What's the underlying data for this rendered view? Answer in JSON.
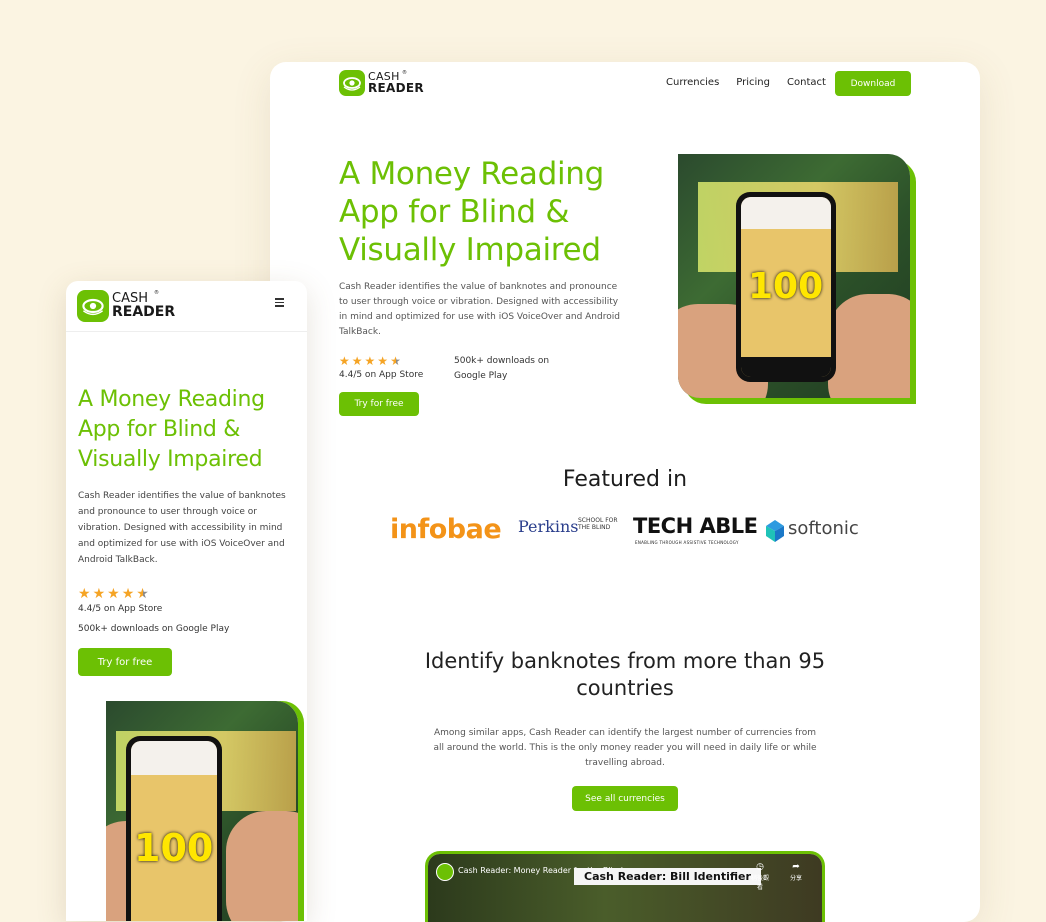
{
  "brand": {
    "line1": "CASH",
    "line2": "READER",
    "reg": "®"
  },
  "colors": {
    "accent": "#6cc004",
    "background": "#fbf4e2",
    "star": "#f5a425"
  },
  "desktop": {
    "nav": {
      "links": [
        "Currencies",
        "Pricing",
        "Contact"
      ],
      "download_label": "Download"
    },
    "hero": {
      "title": "A Money Reading App for Blind & Visually Impaired",
      "description": "Cash Reader identifies the value of banknotes and pronounce to user through voice or vibration. Designed with accessibility in mind and optimized for use with iOS VoiceOver and Android TalkBack.",
      "rating_value": 4.4,
      "rating_text": "4.4/5 on App Store",
      "downloads_text": "500k+ downloads on Google Play",
      "cta_label": "Try for free",
      "image_value": "100"
    },
    "featured": {
      "heading": "Featured in",
      "logos": {
        "infobae": "infobae",
        "perkins": "Perkins",
        "perkins_sub": "SCHOOL FOR THE BLIND",
        "techable": "TECH ABLE",
        "techable_sub": "ENABLING THROUGH ASSISTIVE TECHNOLOGY",
        "softonic": "softonic"
      }
    },
    "identify": {
      "heading": "Identify banknotes from more than 95 countries",
      "description": "Among similar apps, Cash Reader can identify the largest number of currencies from all around the world. This is the only money reader you will need in daily life or while travelling abroad.",
      "cta_label": "See all currencies"
    },
    "video": {
      "title": "Cash Reader: Money Reader for the Blind",
      "thumb_text": "Cash Reader: Bill Identifier",
      "watch_later_label": "稍後觀看",
      "share_label": "分享"
    }
  },
  "mobile": {
    "hero": {
      "title": "A Money Reading App for Blind & Visually Impaired",
      "description": "Cash Reader identifies the value of banknotes and pronounce to user through voice or vibration. Designed with accessibility in mind and optimized for use with iOS VoiceOver and Android TalkBack.",
      "rating_value": 4.4,
      "rating_text": "4.4/5 on App Store",
      "downloads_text": "500k+ downloads on Google Play",
      "cta_label": "Try for free",
      "image_value": "100"
    }
  }
}
